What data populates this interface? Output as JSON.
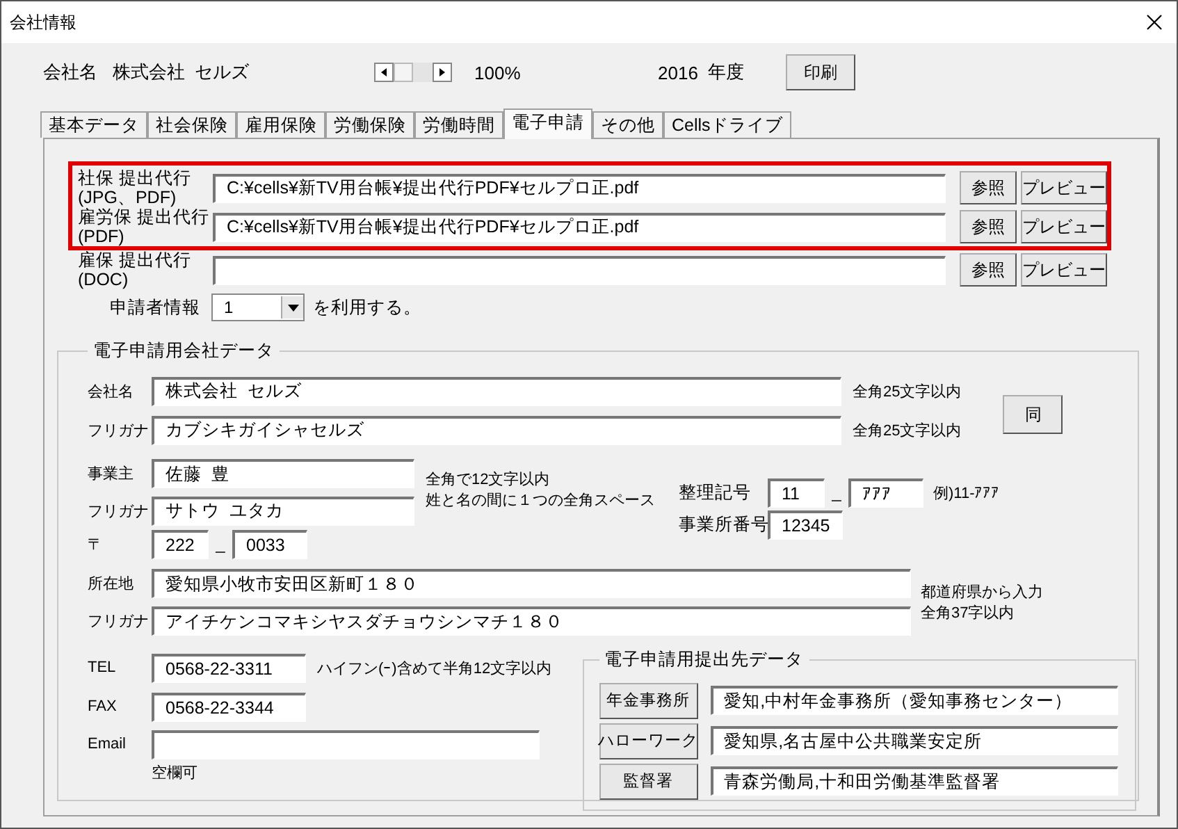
{
  "window": {
    "title": "会社情報"
  },
  "header": {
    "company_label": "会社名",
    "company_name": "株式会社  セルズ",
    "zoom_reading": "100%",
    "year": "2016",
    "year_label": "年度",
    "print_button": "印刷"
  },
  "tabs": [
    {
      "label": "基本データ",
      "selected": false
    },
    {
      "label": "社会保険",
      "selected": false
    },
    {
      "label": "雇用保険",
      "selected": false
    },
    {
      "label": "労働保険",
      "selected": false
    },
    {
      "label": "労働時間",
      "selected": false
    },
    {
      "label": "電子申請",
      "selected": true
    },
    {
      "label": "その他",
      "selected": false
    },
    {
      "label": "Cellsドライブ",
      "selected": false
    }
  ],
  "file_rows": [
    {
      "label": "社保 提出代行\n(JPG、PDF)",
      "value": "C:¥cells¥新TV用台帳¥提出代行PDF¥セルプロ正.pdf",
      "browse_button": "参照",
      "preview_button": "プレビュー",
      "highlighted": true
    },
    {
      "label": "雇労保 提出代行\n(PDF)",
      "value": "C:¥cells¥新TV用台帳¥提出代行PDF¥セルプロ正.pdf",
      "browse_button": "参照",
      "preview_button": "プレビュー",
      "highlighted": true
    },
    {
      "label": "雇保 提出代行\n(DOC)",
      "browse_button": "参照",
      "preview_button": "プレビュー",
      "highlighted": false
    }
  ],
  "applicant": {
    "label": "申請者情報",
    "value": "1",
    "suffix": "を利用する。"
  },
  "company_data": {
    "title": "電子申請用会社データ",
    "name": {
      "label": "会社名",
      "value": "株式会社  セルズ",
      "hint": "全角25文字以内"
    },
    "name_kana": {
      "label": "フリガナ",
      "value": "カブシキガイシャセルズ",
      "hint": "全角25文字以内"
    },
    "same_button": "同",
    "owner": {
      "label": "事業主",
      "value": "佐藤  豊"
    },
    "owner_kana": {
      "label": "フリガナ",
      "value": "サトウ  ユタカ"
    },
    "owner_hints": [
      "全角で12文字以内",
      "姓と名の間に１つの全角スペース"
    ],
    "postal": {
      "label": "〒",
      "part_1": "222",
      "separator": "_",
      "part_2": "0033"
    },
    "reference": {
      "label": "整理記号",
      "part_1": "11",
      "separator": "_",
      "part_2": "ｱｱｱ",
      "example": "例)11-ｱｱｱ"
    },
    "office_number": {
      "label": "事業所番号",
      "value": "12345"
    },
    "address": {
      "label": "所在地",
      "value": "愛知県小牧市安田区新町１８０"
    },
    "address_kana": {
      "label": "フリガナ",
      "value": "アイチケンコマキシヤスダチョウシンマチ１８０"
    },
    "address_hints": [
      "都道府県から入力",
      "全角37字以内"
    ],
    "tel": {
      "label": "TEL",
      "value": "0568-22-3311",
      "hint": "ハイフン(ｰ)含めて半角12文字以内"
    },
    "fax": {
      "label": "FAX",
      "value": "0568-22-3344"
    },
    "email": {
      "label": "Email",
      "hint": "空欄可"
    }
  },
  "destinations": {
    "title": "電子申請用提出先データ",
    "rows": [
      {
        "button": "年金事務所",
        "value": "愛知,中村年金事務所（愛知事務センター）"
      },
      {
        "button": "ハローワーク",
        "value": "愛知県,名古屋中公共職業安定所"
      },
      {
        "button": "監督署",
        "value": "青森労働局,十和田労働基準監督署"
      }
    ]
  }
}
